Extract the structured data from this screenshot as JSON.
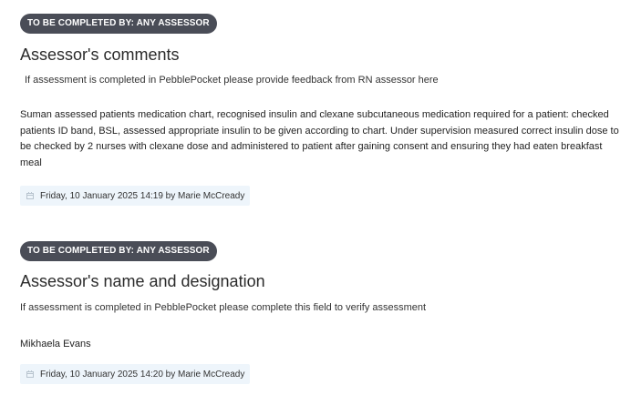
{
  "sections": [
    {
      "badge": "TO BE COMPLETED BY: ANY ASSESSOR",
      "title": "Assessor's comments",
      "hint": "If assessment is completed in PebblePocket please provide feedback from RN assessor here",
      "answer": "Suman assessed patients medication chart, recognised insulin and clexane subcutaneous medication required for a patient: checked patients ID band, BSL, assessed appropriate insulin to be given according to chart. Under supervision measured correct insulin dose to be checked by 2 nurses with clexane dose and administered to patient after gaining consent and ensuring they had eaten breakfast meal",
      "stamp": "Friday, 10 January 2025 14:19 by Marie McCready",
      "stamp_icon": "calendar-icon"
    },
    {
      "badge": "TO BE COMPLETED BY: ANY ASSESSOR",
      "title": "Assessor's name and designation",
      "hint": "If assessment is completed in PebblePocket please complete this field to verify assessment",
      "answer": "Mikhaela Evans",
      "stamp": "Friday, 10 January 2025 14:20 by Marie McCready",
      "stamp_icon": "calendar-icon"
    }
  ],
  "colors": {
    "badge_bg": "#4a4d57",
    "stamp_bg": "#eef5fb"
  }
}
